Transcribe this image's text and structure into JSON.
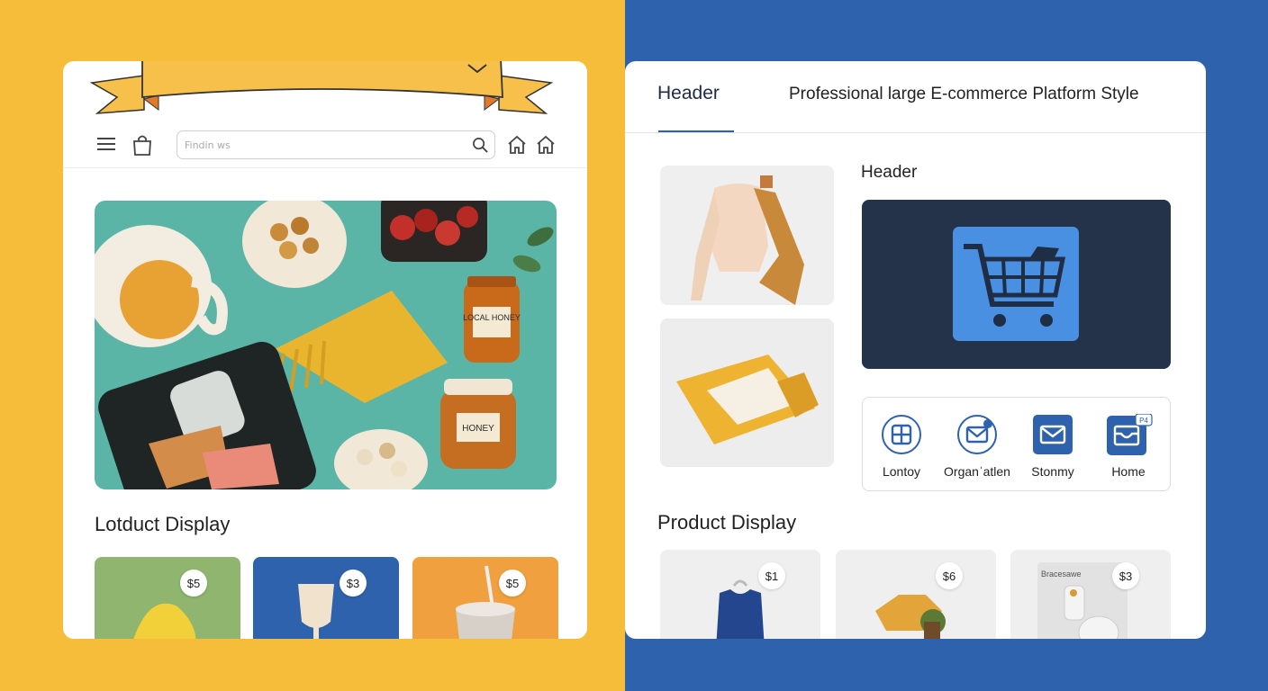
{
  "colors": {
    "left_background": "#f6bd3a",
    "right_background": "#2e62ad",
    "ribbon": "#f7c04a",
    "banner": "#243349",
    "cart_tile": "#4a90e2",
    "accent_blue": "#2e62ad"
  },
  "left_panel": {
    "search": {
      "placeholder": "Findin ws"
    },
    "icons": [
      "menu-icon",
      "bag-icon",
      "search-icon",
      "home-icon",
      "home-icon",
      "chevron-down-icon"
    ],
    "hero": {
      "jar_label_1": "LOCAL HONEY",
      "jar_label_2": "HONEY"
    },
    "section_title": "Lotduct Display",
    "tiles": [
      {
        "price": "$5",
        "color": "#8fb56f"
      },
      {
        "price": "$3",
        "color": "#2e62ad"
      },
      {
        "price": "$5",
        "color": "#f0a03e"
      }
    ]
  },
  "right_panel": {
    "tab_label": "Header",
    "platform_title": "Professional large E-commerce Platform Style",
    "sub_header": "Header",
    "banner_icon": "shopping-cart-icon",
    "icon_items": [
      {
        "label": "Lontoy",
        "icon": "grid-icon"
      },
      {
        "label": "Organˈatlen",
        "icon": "mail-icon"
      },
      {
        "label": "Stonmy",
        "icon": "envelope-icon"
      },
      {
        "label": "Home",
        "icon": "inbox-icon",
        "badge": "P4"
      }
    ],
    "section_title": "Product Display",
    "products": [
      {
        "price": "$1",
        "label": ""
      },
      {
        "price": "$6",
        "label": ""
      },
      {
        "price": "$3",
        "label": "Bracesawe"
      }
    ]
  }
}
